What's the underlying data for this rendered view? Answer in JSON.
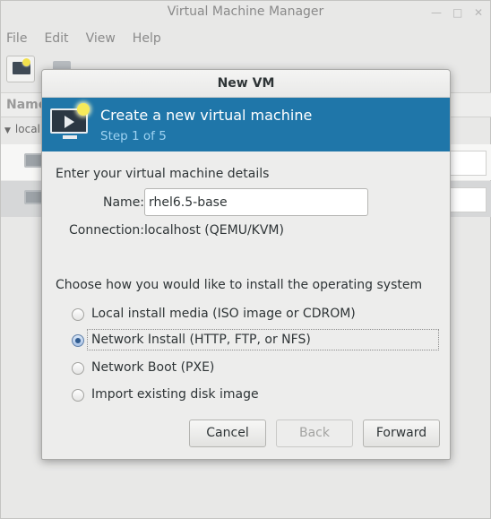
{
  "main": {
    "title": "Virtual Machine Manager",
    "menu": [
      "File",
      "Edit",
      "View",
      "Help"
    ],
    "list_header": "Name",
    "connection_label": "local"
  },
  "dialog": {
    "title": "New VM",
    "banner_title": "Create a new virtual machine",
    "banner_step": "Step 1 of 5",
    "details_heading": "Enter your virtual machine details",
    "name_label": "Name:",
    "name_value": "rhel6.5-base",
    "connection_label": "Connection:",
    "connection_value": "localhost (QEMU/KVM)",
    "install_heading": "Choose how you would like to install the operating system",
    "install_options": [
      {
        "label": "Local install media (ISO image or CDROM)",
        "selected": false
      },
      {
        "label": "Network Install (HTTP, FTP, or NFS)",
        "selected": true
      },
      {
        "label": "Network Boot (PXE)",
        "selected": false
      },
      {
        "label": "Import existing disk image",
        "selected": false
      }
    ],
    "buttons": {
      "cancel": "Cancel",
      "back": "Back",
      "forward": "Forward"
    },
    "accent_color": "#1f76a9"
  }
}
